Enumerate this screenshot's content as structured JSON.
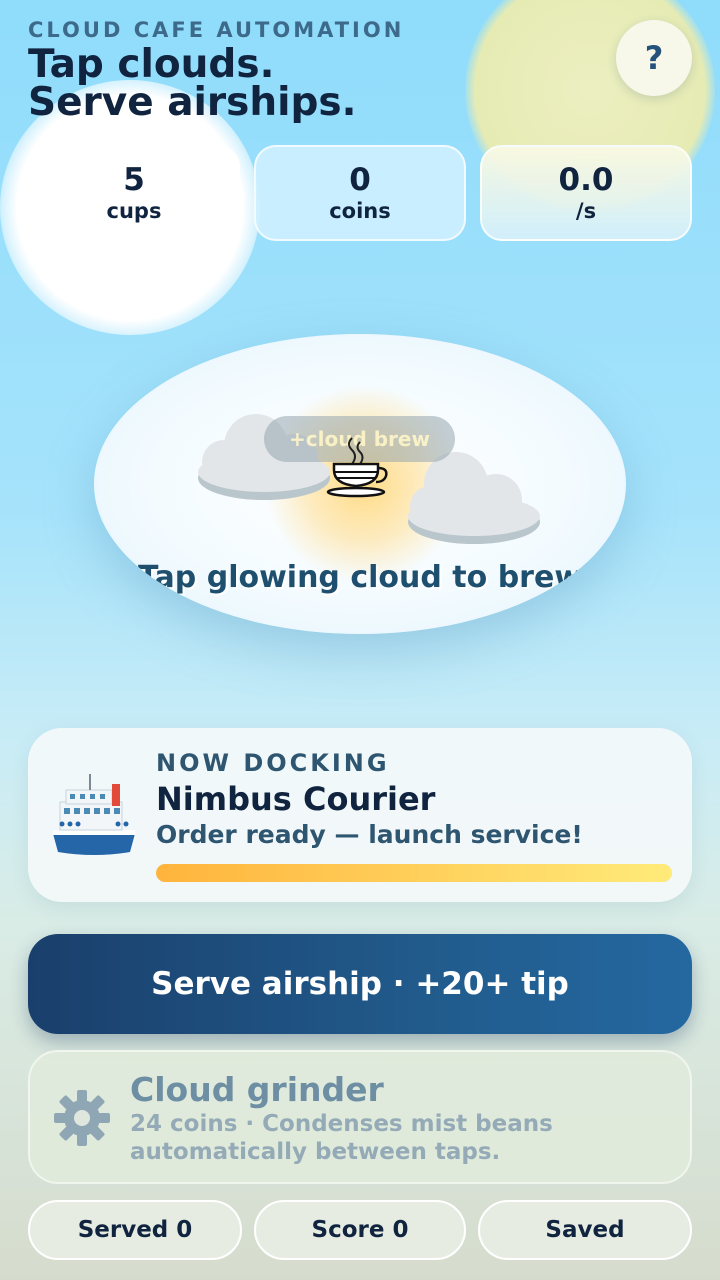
{
  "header": {
    "kicker": "CLOUD CAFE AUTOMATION",
    "title_line1": "Tap clouds.",
    "title_line2": "Serve airships.",
    "help_label": "?"
  },
  "stats": [
    {
      "value": "5",
      "label": "cups"
    },
    {
      "value": "0",
      "label": "coins"
    },
    {
      "value": "0.0",
      "label": "/s"
    }
  ],
  "brew": {
    "float_text": "+cloud brew",
    "hint": "Tap glowing cloud to brew",
    "cup_icon": "coffee-cup-icon"
  },
  "docking": {
    "kicker": "NOW DOCKING",
    "ship_name": "Nimbus Courier",
    "status": "Order ready — launch service!",
    "progress": 1.0,
    "ship_icon": "airship-icon"
  },
  "serve_button": {
    "label": "Serve airship · +20+ tip"
  },
  "upgrade": {
    "title": "Cloud grinder",
    "description": "24 coins · Condenses mist beans automatically between taps.",
    "icon": "gear-icon"
  },
  "footer": {
    "served": "Served 0",
    "score": "Score 0",
    "saved": "Saved"
  },
  "colors": {
    "primary": "#1a3f6c",
    "accent": "#ffcf5a",
    "text": "#10243f"
  }
}
